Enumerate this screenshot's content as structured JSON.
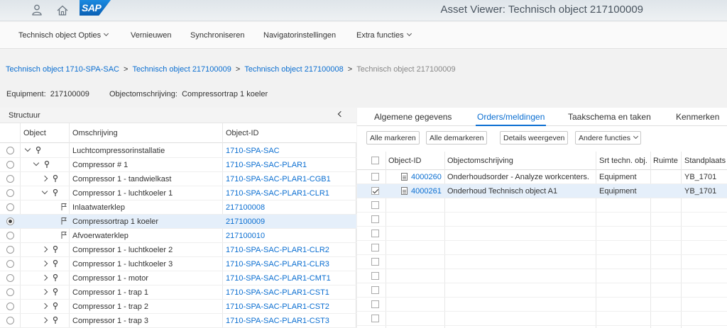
{
  "shell": {
    "logo_text": "SAP",
    "title": "Asset Viewer: Technisch object 217100009",
    "icons": [
      "user-icon",
      "home-icon"
    ]
  },
  "toolbar": {
    "items": [
      {
        "label": "Technisch object Opties",
        "has_dropdown": true
      },
      {
        "label": "Vernieuwen",
        "has_dropdown": false
      },
      {
        "label": "Synchroniseren",
        "has_dropdown": false
      },
      {
        "label": "Navigatorinstellingen",
        "has_dropdown": false
      },
      {
        "label": "Extra functies",
        "has_dropdown": true
      }
    ]
  },
  "breadcrumb": {
    "links": [
      "Technisch object 1710-SPA-SAC",
      "Technisch object 217100009",
      "Technisch object 217100008"
    ],
    "separator": ">",
    "current": "Technisch object 217100009"
  },
  "header": {
    "equipment_label": "Equipment:",
    "equipment_value": "217100009",
    "desc_label": "Objectomschrijving:",
    "desc_value": "Compressortrap 1 koeler"
  },
  "structure": {
    "title": "Structuur",
    "columns": [
      "Object",
      "Omschrijving",
      "Object-ID"
    ],
    "rows": [
      {
        "level": 0,
        "toggle": "open",
        "icon": "pin",
        "desc": "Luchtcompressorinstallatie",
        "id": "1710-SPA-SAC",
        "selected": false
      },
      {
        "level": 1,
        "toggle": "open",
        "icon": "pin",
        "desc": "Compressor # 1",
        "id": "1710-SPA-SAC-PLAR1",
        "selected": false
      },
      {
        "level": 2,
        "toggle": "closed",
        "icon": "pin",
        "desc": "Compressor 1 - tandwielkast",
        "id": "1710-SPA-SAC-PLAR1-CGB1",
        "selected": false
      },
      {
        "level": 2,
        "toggle": "open",
        "icon": "pin",
        "desc": "Compressor 1 - luchtkoeler 1",
        "id": "1710-SPA-SAC-PLAR1-CLR1",
        "selected": false
      },
      {
        "level": 3,
        "toggle": "none",
        "icon": "flag",
        "desc": "Inlaatwaterklep",
        "id": "217100008",
        "selected": false
      },
      {
        "level": 3,
        "toggle": "none",
        "icon": "flag",
        "desc": "Compressortrap 1 koeler",
        "id": "217100009",
        "selected": true
      },
      {
        "level": 3,
        "toggle": "none",
        "icon": "flag",
        "desc": "Afvoerwaterklep",
        "id": "217100010",
        "selected": false
      },
      {
        "level": 2,
        "toggle": "closed",
        "icon": "pin",
        "desc": "Compressor 1 - luchtkoeler 2",
        "id": "1710-SPA-SAC-PLAR1-CLR2",
        "selected": false
      },
      {
        "level": 2,
        "toggle": "closed",
        "icon": "pin",
        "desc": "Compressor 1 - luchtkoeler 3",
        "id": "1710-SPA-SAC-PLAR1-CLR3",
        "selected": false
      },
      {
        "level": 2,
        "toggle": "closed",
        "icon": "pin",
        "desc": "Compressor 1 - motor",
        "id": "1710-SPA-SAC-PLAR1-CMT1",
        "selected": false
      },
      {
        "level": 2,
        "toggle": "closed",
        "icon": "pin",
        "desc": "Compressor 1 - trap 1",
        "id": "1710-SPA-SAC-PLAR1-CST1",
        "selected": false
      },
      {
        "level": 2,
        "toggle": "closed",
        "icon": "pin",
        "desc": "Compressor 1 - trap 2",
        "id": "1710-SPA-SAC-PLAR1-CST2",
        "selected": false
      },
      {
        "level": 2,
        "toggle": "closed",
        "icon": "pin",
        "desc": "Compressor 1 - trap 3",
        "id": "1710-SPA-SAC-PLAR1-CST3",
        "selected": false
      }
    ]
  },
  "details": {
    "tabs": [
      {
        "label": "Algemene gegevens",
        "active": false
      },
      {
        "label": "Orders/meldingen",
        "active": true
      },
      {
        "label": "Taakschema en taken",
        "active": false
      },
      {
        "label": "Kenmerken",
        "active": false
      }
    ],
    "buttons": [
      {
        "label": "Alle markeren",
        "has_dropdown": false
      },
      {
        "label": "Alle demarkeren",
        "has_dropdown": false
      },
      {
        "label": "Details weergeven",
        "has_dropdown": false
      },
      {
        "label": "Andere functies",
        "has_dropdown": true
      }
    ],
    "columns": [
      "Object-ID",
      "Objectomschrijving",
      "Srt techn. obj.",
      "Ruimte",
      "Standplaats"
    ],
    "rows": [
      {
        "checked": false,
        "id": "4000260",
        "desc": "Onderhoudsorder - Analyze workcenters.",
        "type": "Equipment",
        "room": "",
        "location": "YB_1701"
      },
      {
        "checked": true,
        "id": "4000261",
        "desc": "Onderhoud Technisch object A1",
        "type": "Equipment",
        "room": "",
        "location": "YB_1701"
      }
    ],
    "empty_rows": 9
  },
  "colors": {
    "link": "#0a6ed1",
    "selected_row": "#e5effa",
    "sap_blue": "#0a5fb4"
  }
}
